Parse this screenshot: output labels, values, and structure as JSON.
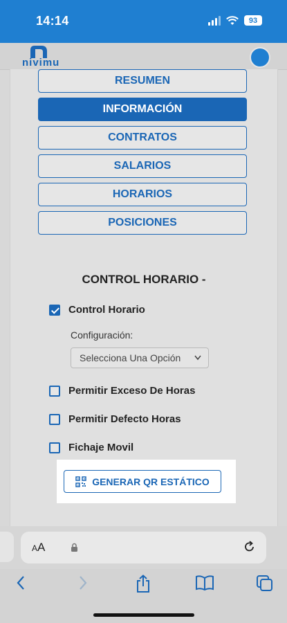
{
  "status_bar": {
    "time": "14:14",
    "battery": "93"
  },
  "brand": {
    "logo_text": "nivimu"
  },
  "tabs": [
    {
      "label": "RESUMEN",
      "active": false
    },
    {
      "label": "INFORMACIÓN",
      "active": true
    },
    {
      "label": "CONTRATOS",
      "active": false
    },
    {
      "label": "SALARIOS",
      "active": false
    },
    {
      "label": "HORARIOS",
      "active": false
    },
    {
      "label": "POSICIONES",
      "active": false
    }
  ],
  "control": {
    "title": "CONTROL HORARIO -",
    "control_horario": {
      "label": "Control Horario",
      "checked": true
    },
    "config_label": "Configuración:",
    "select_value": "Selecciona Una Opción",
    "exceso": {
      "label": "Permitir Exceso De Horas",
      "checked": false
    },
    "defecto": {
      "label": "Permitir Defecto Horas",
      "checked": false
    },
    "fichaje": {
      "label": "Fichaje Movil",
      "checked": false
    },
    "qr_button": "GENERAR QR ESTÁTICO"
  },
  "browser": {
    "aa_label": "A",
    "aa_label_big": "A"
  },
  "colors": {
    "accent": "#1a66b5",
    "status_bar": "#1f7fd1"
  }
}
